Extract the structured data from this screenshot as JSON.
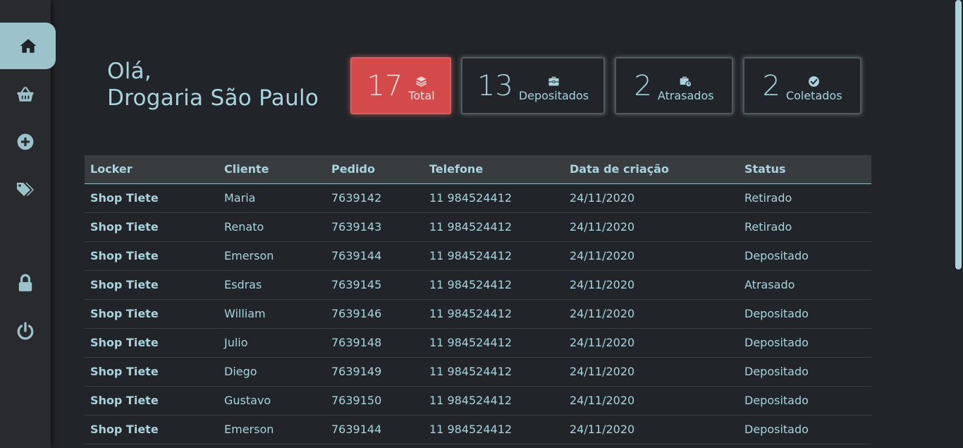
{
  "greeting": {
    "line1": "Olá,",
    "line2": "Drogaria São Paulo"
  },
  "sidebar": {
    "items": [
      {
        "icon": "home-icon",
        "active": true
      },
      {
        "icon": "basket-icon",
        "active": false
      },
      {
        "icon": "plus-circle-icon",
        "active": false
      },
      {
        "icon": "tags-icon",
        "active": false
      },
      {
        "icon": "lock-icon",
        "active": false
      },
      {
        "icon": "power-icon",
        "active": false
      }
    ]
  },
  "stats": [
    {
      "value": "17",
      "label": "Total",
      "icon": "layers-icon"
    },
    {
      "value": "13",
      "label": "Depositados",
      "icon": "briefcase-icon"
    },
    {
      "value": "2",
      "label": "Atrasados",
      "icon": "briefcase-clock-icon"
    },
    {
      "value": "2",
      "label": "Coletados",
      "icon": "check-circle-icon"
    }
  ],
  "table": {
    "headers": [
      "Locker",
      "Cliente",
      "Pedido",
      "Telefone",
      "Data de criação",
      "Status"
    ],
    "rows": [
      [
        "Shop Tiete",
        "Maria",
        "7639142",
        "11 984524412",
        "24/11/2020",
        "Retirado"
      ],
      [
        "Shop Tiete",
        "Renato",
        "7639143",
        "11 984524412",
        "24/11/2020",
        "Retirado"
      ],
      [
        "Shop Tiete",
        "Emerson",
        "7639144",
        "11 984524412",
        "24/11/2020",
        "Depositado"
      ],
      [
        "Shop Tiete",
        "Esdras",
        "7639145",
        "11 984524412",
        "24/11/2020",
        "Atrasado"
      ],
      [
        "Shop Tiete",
        "William",
        "7639146",
        "11 984524412",
        "24/11/2020",
        "Depositado"
      ],
      [
        "Shop Tiete",
        "Julio",
        "7639148",
        "11 984524412",
        "24/11/2020",
        "Depositado"
      ],
      [
        "Shop Tiete",
        "Diego",
        "7639149",
        "11 984524412",
        "24/11/2020",
        "Depositado"
      ],
      [
        "Shop Tiete",
        "Gustavo",
        "7639150",
        "11 984524412",
        "24/11/2020",
        "Depositado"
      ],
      [
        "Shop Tiete",
        "Emerson",
        "7639144",
        "11 984524412",
        "24/11/2020",
        "Depositado"
      ]
    ]
  },
  "colors": {
    "background": "#212428",
    "sidebar": "#282a2d",
    "accent": "#a9d3dd",
    "active_nav": "#9cc3cb",
    "primary_card": "#d44a4a"
  }
}
